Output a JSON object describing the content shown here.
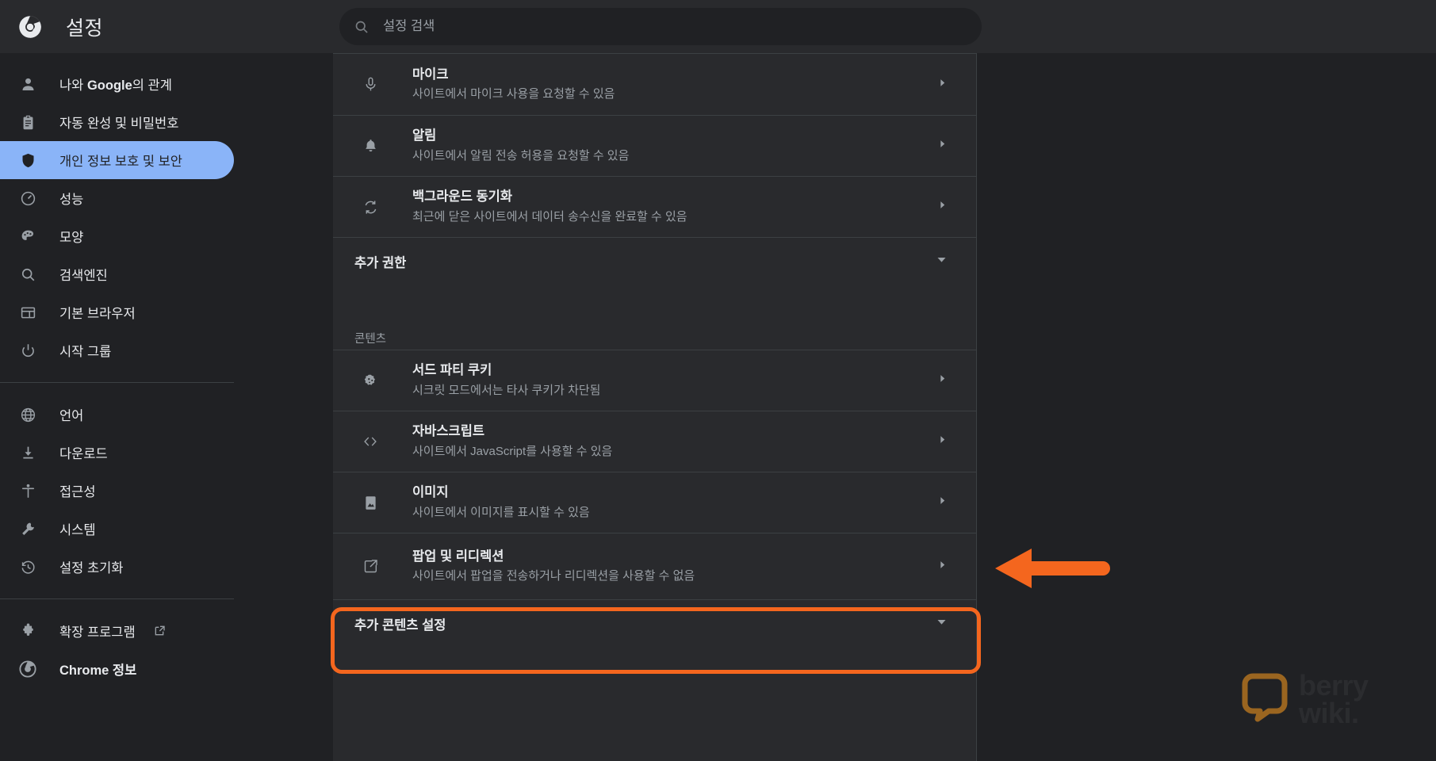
{
  "accent": {
    "selected_nav_bg": "#8ab4f8",
    "highlight_orange": "#f4661e",
    "page_bg": "#202124",
    "card_bg": "#292a2d"
  },
  "header": {
    "logo_icon": "chrome-logo-icon",
    "title": "설정",
    "search": {
      "icon": "search-icon",
      "placeholder": "설정 검색",
      "value": ""
    }
  },
  "sidebar": {
    "groups": [
      {
        "items": [
          {
            "icon": "person-icon",
            "label": "나와 Google의 관계",
            "selected": false,
            "bold_part": "Google"
          },
          {
            "icon": "clipboard-key-icon",
            "label": "자동 완성 및 비밀번호",
            "selected": false
          },
          {
            "icon": "shield-icon",
            "label": "개인 정보 보호 및 보안",
            "selected": true
          },
          {
            "icon": "speedometer-icon",
            "label": "성능",
            "selected": false
          },
          {
            "icon": "palette-icon",
            "label": "모양",
            "selected": false
          },
          {
            "icon": "search-icon",
            "label": "검색엔진",
            "selected": false
          },
          {
            "icon": "browser-window-icon",
            "label": "기본 브라우저",
            "selected": false
          },
          {
            "icon": "power-icon",
            "label": "시작 그룹",
            "selected": false
          }
        ]
      },
      {
        "items": [
          {
            "icon": "globe-icon",
            "label": "언어",
            "selected": false
          },
          {
            "icon": "download-icon",
            "label": "다운로드",
            "selected": false
          },
          {
            "icon": "accessibility-icon",
            "label": "접근성",
            "selected": false
          },
          {
            "icon": "wrench-icon",
            "label": "시스템",
            "selected": false
          },
          {
            "icon": "history-restore-icon",
            "label": "설정 초기화",
            "selected": false
          }
        ]
      },
      {
        "items": [
          {
            "icon": "puzzle-icon",
            "label": "확장 프로그램",
            "selected": false,
            "external_link_icon": "external-link-icon"
          },
          {
            "icon": "chrome-logo-icon",
            "label": "Chrome 정보",
            "selected": false,
            "bold": true
          }
        ]
      }
    ]
  },
  "main": {
    "permission_rows": [
      {
        "icon": "microphone-icon",
        "title": "마이크",
        "subtitle": "사이트에서 마이크 사용을 요청할 수 있음",
        "chevron": "chevron-right-icon"
      },
      {
        "icon": "bell-icon",
        "title": "알림",
        "subtitle": "사이트에서 알림 전송 허용을 요청할 수 있음",
        "chevron": "chevron-right-icon"
      },
      {
        "icon": "sync-icon",
        "title": "백그라운드 동기화",
        "subtitle": "최근에 닫은 사이트에서 데이터 송수신을 완료할 수 있음",
        "chevron": "chevron-right-icon"
      }
    ],
    "additional_permissions": {
      "label": "추가 권한",
      "chevron": "chevron-down-icon"
    },
    "content_group_label": "콘텐츠",
    "content_rows": [
      {
        "icon": "cookie-icon",
        "title": "서드 파티 쿠키",
        "subtitle": "시크릿 모드에서는 타사 쿠키가 차단됨",
        "chevron": "chevron-right-icon",
        "highlighted": false
      },
      {
        "icon": "code-brackets-icon",
        "title": "자바스크립트",
        "subtitle": "사이트에서 JavaScript를 사용할 수 있음",
        "chevron": "chevron-right-icon",
        "highlighted": false
      },
      {
        "icon": "image-icon",
        "title": "이미지",
        "subtitle": "사이트에서 이미지를 표시할 수 있음",
        "chevron": "chevron-right-icon",
        "highlighted": false
      },
      {
        "icon": "popup-window-icon",
        "title": "팝업 및 리디렉션",
        "subtitle": "사이트에서 팝업을 전송하거나 리디렉션을 사용할 수 없음",
        "chevron": "chevron-right-icon",
        "highlighted": true
      }
    ],
    "additional_content_settings": {
      "label": "추가 콘텐츠 설정",
      "chevron": "chevron-down-icon"
    }
  },
  "annotations": {
    "arrow": {
      "icon": "left-arrow-annotation",
      "color": "#f4661e",
      "points_to": "팝업 및 리디렉션"
    },
    "highlight_target": "팝업 및 리디렉션"
  },
  "watermark": {
    "icon": "speech-bubble-icon",
    "line1": "berry",
    "line2": "wiki."
  }
}
